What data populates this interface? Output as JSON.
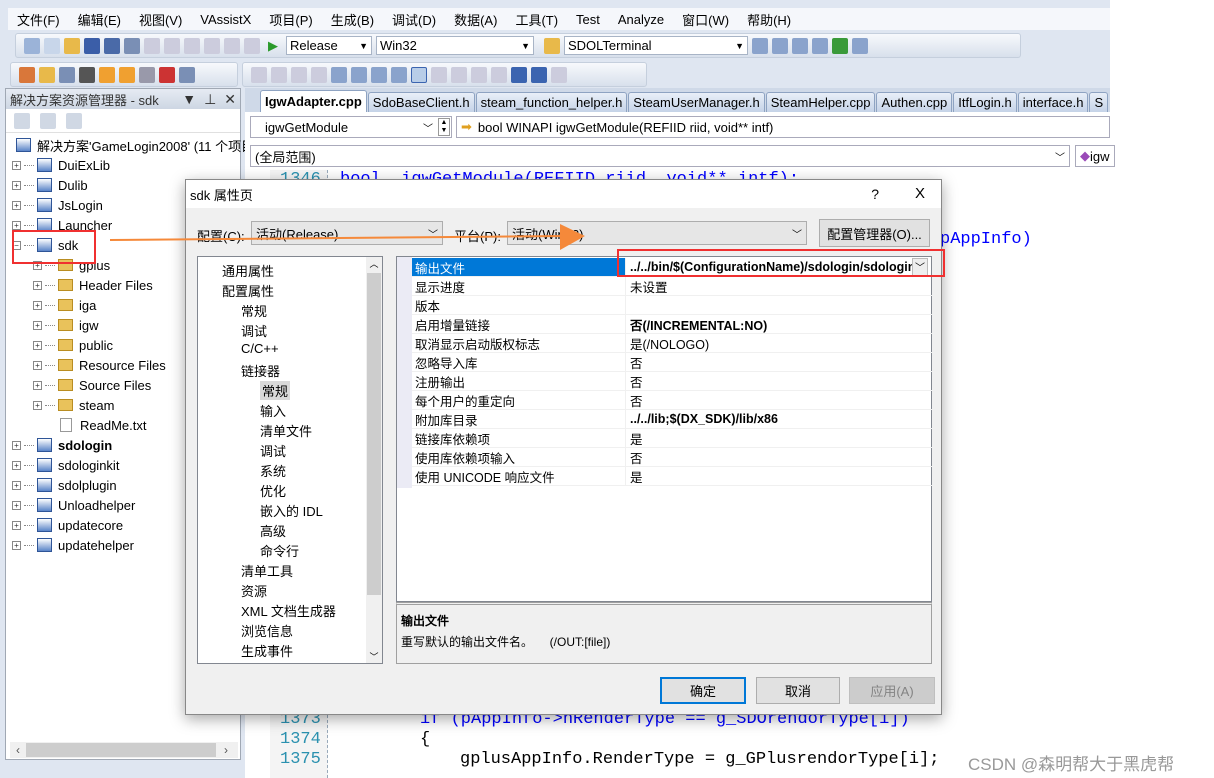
{
  "menu": [
    "文件(F)",
    "编辑(E)",
    "视图(V)",
    "VAssistX",
    "项目(P)",
    "生成(B)",
    "调试(D)",
    "数据(A)",
    "工具(T)",
    "Test",
    "Analyze",
    "窗口(W)",
    "帮助(H)"
  ],
  "toolbar": {
    "config": "Release",
    "platform": "Win32",
    "startup": "SDOLTerminal"
  },
  "solution_explorer": {
    "title": "解决方案资源管理器 - sdk",
    "solution": "解决方案'GameLogin2008' (11 个项目",
    "projects_before": [
      "DuiExLib",
      "Dulib",
      "JsLogin",
      "Launcher"
    ],
    "selected": "sdk",
    "children": [
      "gplus",
      "Header Files",
      "iga",
      "igw",
      "public",
      "Resource Files",
      "Source Files",
      "steam"
    ],
    "file": "ReadMe.txt",
    "projects_after": [
      "sdologin",
      "sdologinkit",
      "sdolplugin",
      "Unloadhelper",
      "updatecore",
      "updatehelper"
    ],
    "bold_project": "sdologin"
  },
  "editor": {
    "tabs": [
      "IgwAdapter.cpp",
      "SdoBaseClient.h",
      "steam_function_helper.h",
      "SteamUserManager.h",
      "SteamHelper.cpp",
      "Authen.cpp",
      "ItfLogin.h",
      "interface.h",
      "S"
    ],
    "function_combo": "igwGetModule",
    "signature": "bool WINAPI igwGetModule(REFIID riid, void** intf)",
    "scope": "(全局范围)",
    "member_combo": "igw",
    "lines": [
      {
        "n": "1346",
        "text": "bool  igwGetModule(REFIID riid, void** intf);"
      },
      {
        "n": "",
        "text": "pAppInfo)"
      },
      {
        "n": "1373",
        "text": "if (pAppInfo->nRenderType == g_SDOrendorType[i])"
      },
      {
        "n": "1374",
        "text": "{"
      },
      {
        "n": "1375",
        "text": "gplusAppInfo.RenderType = g_GPlusrendorType[i];"
      }
    ]
  },
  "dialog": {
    "title": "sdk 属性页",
    "help": "?",
    "close": "X",
    "config_label": "配置(C):",
    "config_value": "活动(Release)",
    "platform_label": "平台(P):",
    "platform_value": "活动(Win32)",
    "config_manager": "配置管理器(O)...",
    "tree": [
      {
        "label": "通用属性",
        "level": 0
      },
      {
        "label": "配置属性",
        "level": 0
      },
      {
        "label": "常规",
        "level": 1
      },
      {
        "label": "调试",
        "level": 1
      },
      {
        "label": "C/C++",
        "level": 1
      },
      {
        "label": "链接器",
        "level": 1
      },
      {
        "label": "常规",
        "level": 2,
        "selected": true
      },
      {
        "label": "输入",
        "level": 2
      },
      {
        "label": "清单文件",
        "level": 2
      },
      {
        "label": "调试",
        "level": 2
      },
      {
        "label": "系统",
        "level": 2
      },
      {
        "label": "优化",
        "level": 2
      },
      {
        "label": "嵌入的 IDL",
        "level": 2
      },
      {
        "label": "高级",
        "level": 2
      },
      {
        "label": "命令行",
        "level": 2
      },
      {
        "label": "清单工具",
        "level": 1
      },
      {
        "label": "资源",
        "level": 1
      },
      {
        "label": "XML 文档生成器",
        "level": 1
      },
      {
        "label": "浏览信息",
        "level": 1
      },
      {
        "label": "生成事件",
        "level": 1
      }
    ],
    "properties": [
      {
        "name": "输出文件",
        "value": "../../bin/$(ConfigurationName)/sdologin/sdologin",
        "bold": true,
        "selected": true
      },
      {
        "name": "显示进度",
        "value": "未设置"
      },
      {
        "name": "版本",
        "value": ""
      },
      {
        "name": "启用增量链接",
        "value": "否(/INCREMENTAL:NO)",
        "bold": true
      },
      {
        "name": "取消显示启动版权标志",
        "value": "是(/NOLOGO)"
      },
      {
        "name": "忽略导入库",
        "value": "否"
      },
      {
        "name": "注册输出",
        "value": "否"
      },
      {
        "name": "每个用户的重定向",
        "value": "否"
      },
      {
        "name": "附加库目录",
        "value": "../../lib;$(DX_SDK)/lib/x86",
        "bold": true
      },
      {
        "name": "链接库依赖项",
        "value": "是"
      },
      {
        "name": "使用库依赖项输入",
        "value": "否"
      },
      {
        "name": "使用 UNICODE 响应文件",
        "value": "是"
      }
    ],
    "desc_title": "输出文件",
    "desc_text": "重写默认的输出文件名。     (/OUT:[file])",
    "ok": "确定",
    "cancel": "取消",
    "apply": "应用(A)"
  },
  "watermark": "CSDN @森明帮大于黑虎帮",
  "colors": {
    "highlight": "#f03030",
    "arrow": "#f5893a",
    "selection": "#0078d7",
    "keyword": "#0000ff"
  }
}
